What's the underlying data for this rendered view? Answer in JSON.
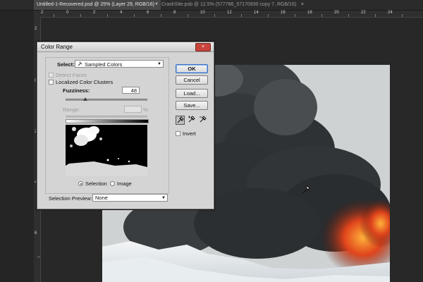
{
  "tabs": [
    {
      "label": "Untitled-1-Recovered.psd @ 25% (Layer 29, RGB/16) *",
      "close": "×"
    },
    {
      "label": "CrashSite.psb @ 12.5% (577786_57170930 copy 7, RGB/16)",
      "close": "×"
    }
  ],
  "ruler": {
    "top": [
      "2",
      "0",
      "2",
      "4",
      "6",
      "8",
      "10",
      "12",
      "14",
      "16",
      "18",
      "20",
      "22",
      "24"
    ],
    "left": [
      "2",
      "0",
      "2",
      "4",
      "6"
    ]
  },
  "dialog": {
    "title": "Color Range",
    "close": "×",
    "select_label": "Select:",
    "select_value": "Sampled Colors",
    "detect_faces": "Detect Faces",
    "localized": "Localized Color Clusters",
    "fuzziness_label": "Fuzziness:",
    "fuzziness_value": "48",
    "fuzziness_fraction": 0.24,
    "range_label": "Range:",
    "range_unit": "%",
    "selection_radio": "Selection",
    "image_radio": "Image",
    "preview_label": "Selection Preview:",
    "preview_value": "None",
    "buttons": {
      "ok": "OK",
      "cancel": "Cancel",
      "load": "Load...",
      "save": "Save..."
    },
    "invert": "Invert"
  },
  "icons": {
    "eyedropper": "eyedropper-icon",
    "eyedropper_plus": "eyedropper-plus-icon",
    "eyedropper_minus": "eyedropper-minus-icon"
  },
  "colors": {
    "accent": "#3a73c4",
    "lava": "#e0441c"
  }
}
